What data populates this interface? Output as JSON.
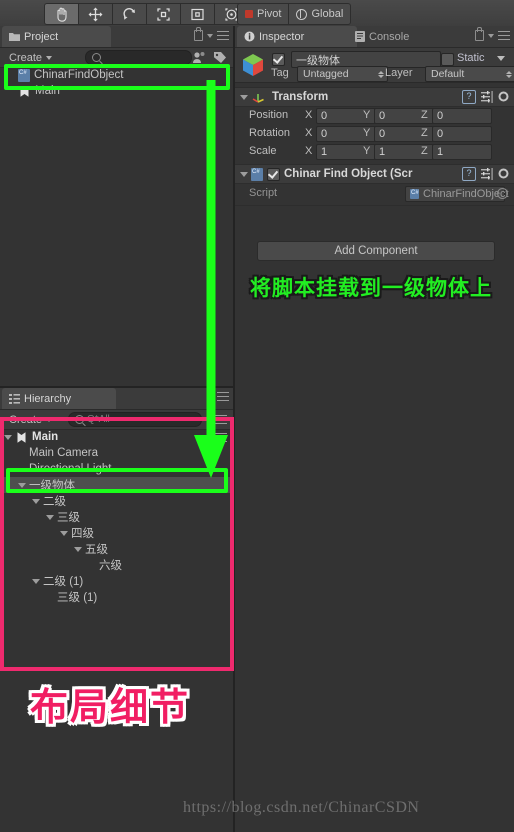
{
  "toolbar": {
    "tools": [
      {
        "name": "hand-tool",
        "selected": true
      },
      {
        "name": "move-tool",
        "selected": false
      },
      {
        "name": "rotate-tool",
        "selected": false
      },
      {
        "name": "scale-tool",
        "selected": false
      },
      {
        "name": "rect-tool",
        "selected": false
      },
      {
        "name": "transform-tool",
        "selected": false
      }
    ],
    "pivot_label": "Pivot",
    "global_label": "Global"
  },
  "project_panel": {
    "tab_label": "Project",
    "create_label": "Create",
    "search_placeholder": "",
    "items": [
      {
        "label": "ChinarFindObject",
        "icon": "csharp-script-icon",
        "indent": 0,
        "selected": false
      },
      {
        "label": "Main",
        "icon": "unity-scene-icon",
        "indent": 0,
        "selected": false
      }
    ]
  },
  "hierarchy_panel": {
    "tab_label": "Hierarchy",
    "create_label": "Create",
    "search_value": "Q*All",
    "items": [
      {
        "label": "Main",
        "indent": 0,
        "fold": true,
        "icon": "unity-scene-icon",
        "selected": false,
        "bold": true
      },
      {
        "label": "Main Camera",
        "indent": 1,
        "fold": false,
        "icon": "",
        "selected": false,
        "bold": false
      },
      {
        "label": "Directional Light",
        "indent": 1,
        "fold": false,
        "icon": "",
        "selected": false,
        "bold": false
      },
      {
        "label": "一级物体",
        "indent": 1,
        "fold": true,
        "icon": "",
        "selected": true,
        "bold": false
      },
      {
        "label": "二级",
        "indent": 2,
        "fold": true,
        "icon": "",
        "selected": false,
        "bold": false
      },
      {
        "label": "三级",
        "indent": 3,
        "fold": true,
        "icon": "",
        "selected": false,
        "bold": false
      },
      {
        "label": "四级",
        "indent": 4,
        "fold": true,
        "icon": "",
        "selected": false,
        "bold": false
      },
      {
        "label": "五级",
        "indent": 5,
        "fold": true,
        "icon": "",
        "selected": false,
        "bold": false
      },
      {
        "label": "六级",
        "indent": 6,
        "fold": false,
        "icon": "",
        "selected": false,
        "bold": false
      },
      {
        "label": "二级 (1)",
        "indent": 2,
        "fold": true,
        "icon": "",
        "selected": false,
        "bold": false
      },
      {
        "label": "三级 (1)",
        "indent": 3,
        "fold": false,
        "icon": "",
        "selected": false,
        "bold": false
      }
    ]
  },
  "inspector_panel": {
    "tabs": [
      {
        "label": "Inspector",
        "icon": "info-icon",
        "active": true
      },
      {
        "label": "Console",
        "icon": "console-icon",
        "active": false
      }
    ],
    "gameobject": {
      "enabled": true,
      "name": "一级物体",
      "static_label": "Static",
      "static_checked": false,
      "tag_label": "Tag",
      "tag_value": "Untagged",
      "layer_label": "Layer",
      "layer_value": "Default"
    },
    "transform": {
      "title": "Transform",
      "rows": [
        {
          "label": "Position",
          "x": "0",
          "y": "0",
          "z": "0"
        },
        {
          "label": "Rotation",
          "x": "0",
          "y": "0",
          "z": "0"
        },
        {
          "label": "Scale",
          "x": "1",
          "y": "1",
          "z": "1"
        }
      ],
      "axis_labels": [
        "X",
        "Y",
        "Z"
      ]
    },
    "script_component": {
      "title": "Chinar Find Object (Scr",
      "enabled": true,
      "script_label": "Script",
      "script_value": "ChinarFindObject"
    },
    "add_component_label": "Add Component"
  },
  "annotations": {
    "green_text": "将脚本挂载到一级物体上",
    "pink_text": "布局细节",
    "green_color": "#1aff1a",
    "pink_color": "#ef2a6e"
  },
  "watermark": "https://blog.csdn.net/ChinarCSDN"
}
